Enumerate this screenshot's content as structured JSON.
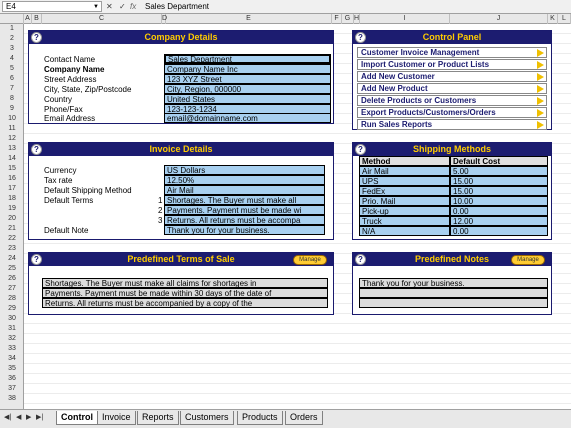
{
  "formula_bar": {
    "cell_ref": "E4",
    "value": "Sales Department",
    "cancel": "✕",
    "confirm": "✓",
    "fx": "fx"
  },
  "columns": [
    "A",
    "B",
    "C",
    "D",
    "E",
    "F",
    "G",
    "H",
    "I",
    "J",
    "K",
    "L"
  ],
  "rows": [
    "1",
    "2",
    "3",
    "4",
    "5",
    "6",
    "7",
    "8",
    "9",
    "10",
    "11",
    "12",
    "13",
    "14",
    "15",
    "16",
    "17",
    "18",
    "19",
    "20",
    "21",
    "22",
    "23",
    "24",
    "25",
    "26",
    "27",
    "28",
    "29",
    "30",
    "31",
    "32",
    "33",
    "34",
    "35",
    "36",
    "37",
    "38"
  ],
  "company": {
    "title": "Company Details",
    "labels": [
      "Contact Name",
      "Company Name",
      "Street Address",
      "City, State, Zip/Postcode",
      "Country",
      "Phone/Fax",
      "Email Address"
    ],
    "values": [
      "Sales Department",
      "Company Name Inc",
      "123 XYZ Street",
      "City, Region, 000000",
      "United States",
      "123-123-1234",
      "email@domainname.com"
    ]
  },
  "control": {
    "title": "Control Panel",
    "buttons": [
      "Customer Invoice Management",
      "Import Customer or Product Lists",
      "Add New Customer",
      "Add New Product",
      "Delete Products or Customers",
      "Export Products/Customers/Orders",
      "Run Sales Reports"
    ]
  },
  "invoice": {
    "title": "Invoice Details",
    "labels": [
      "Currency",
      "Tax rate",
      "Default Shipping Method",
      "Default Terms",
      "Default Note"
    ],
    "values": [
      "US Dollars",
      "12.50%",
      "Air Mail"
    ],
    "terms": [
      "Shortages. The Buyer must make all",
      "Payments. Payment must be made wi",
      "Returns. All returns must be accompa"
    ],
    "term_nums": [
      "1",
      "2",
      "3"
    ],
    "note": "Thank you for your business."
  },
  "shipping": {
    "title": "Shipping Methods",
    "headers": [
      "Method",
      "Default Cost"
    ],
    "rows": [
      [
        "Air Mail",
        "5.00"
      ],
      [
        "UPS",
        "15.00"
      ],
      [
        "FedEx",
        "15.00"
      ],
      [
        "Prio. Mail",
        "10.00"
      ],
      [
        "Pick-up",
        "0.00"
      ],
      [
        "Truck",
        "12.00"
      ],
      [
        "N/A",
        "0.00"
      ]
    ]
  },
  "terms_panel": {
    "title": "Predefined Terms of Sale",
    "manage": "Manage",
    "lines": [
      "Shortages. The Buyer must make all claims for shortages in",
      "Payments. Payment must be made within 30 days of the date of",
      "Returns. All returns must be accompanied by a copy of the"
    ]
  },
  "notes_panel": {
    "title": "Predefined Notes",
    "manage": "Manage",
    "lines": [
      "Thank you for your business."
    ]
  },
  "tabs": [
    "Control",
    "Invoice",
    "Reports",
    "Customers",
    "Products",
    "Orders"
  ],
  "colors": {
    "panel_header": "#1c1c70",
    "panel_title": "#ffcc00",
    "field": "#a8d0f0"
  }
}
